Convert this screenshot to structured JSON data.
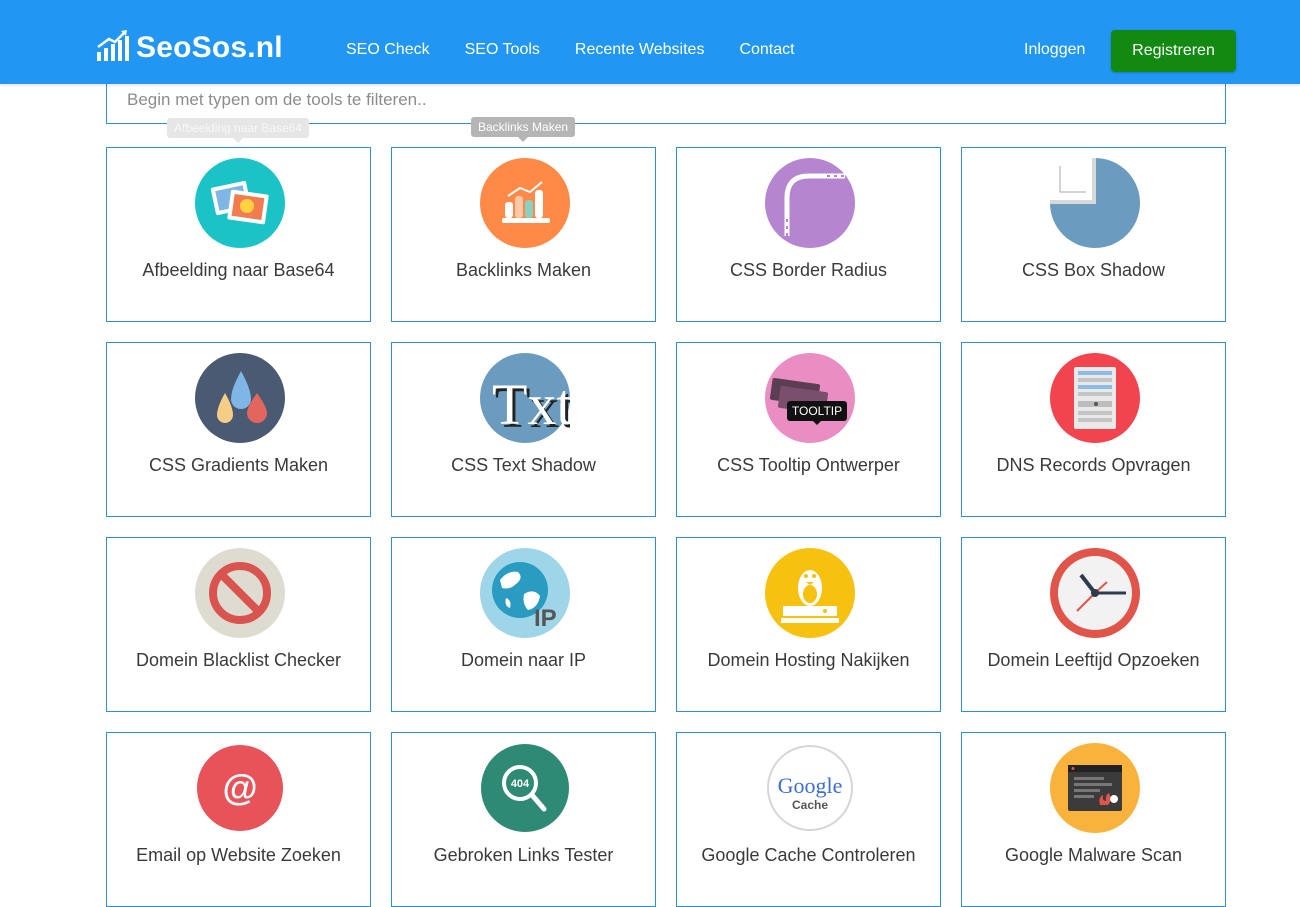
{
  "brand": {
    "name": "SeoSos.nl",
    "logo_icon": "bar-chart-up-icon"
  },
  "nav": {
    "links": [
      "SEO Check",
      "SEO Tools",
      "Recente Websites",
      "Contact"
    ],
    "login": "Inloggen",
    "register": "Registreren"
  },
  "search": {
    "placeholder": "Begin met typen om de tools te filteren.."
  },
  "tooltips": [
    "Afbeelding naar Base64",
    "Backlinks Maken"
  ],
  "tools": [
    {
      "label": "Afbeelding naar Base64",
      "icon": "image-icon",
      "color": "#1bc3c6"
    },
    {
      "label": "Backlinks Maken",
      "icon": "backlinks-chart-icon",
      "color": "#ff8a47"
    },
    {
      "label": "CSS Border Radius",
      "icon": "border-radius-icon",
      "color": "#b586cf"
    },
    {
      "label": "CSS Box Shadow",
      "icon": "box-shadow-icon",
      "color": "#6b9bbf"
    },
    {
      "label": "CSS Gradients Maken",
      "icon": "color-drops-icon",
      "color": "#4a5a72"
    },
    {
      "label": "CSS Text Shadow",
      "icon": "text-shadow-icon",
      "color": "#6b9bbf",
      "glyph": "Txt"
    },
    {
      "label": "CSS Tooltip Ontwerper",
      "icon": "tooltip-icon",
      "color": "#e98dc2",
      "glyph": "TOOLTIP"
    },
    {
      "label": "DNS Records Opvragen",
      "icon": "server-icon",
      "color": "#f2444f"
    },
    {
      "label": "Domein Blacklist Checker",
      "icon": "blocked-icon",
      "color": "#dedcd0"
    },
    {
      "label": "Domein naar IP",
      "icon": "globe-icon",
      "color": "#9ed5e8",
      "glyph": "IP"
    },
    {
      "label": "Domein Hosting Nakijken",
      "icon": "linux-server-icon",
      "color": "#f6c20f"
    },
    {
      "label": "Domein Leeftijd Opzoeken",
      "icon": "clock-icon",
      "color": "#e0544a"
    },
    {
      "label": "Email op Website Zoeken",
      "icon": "at-sign-icon",
      "color": "#e8535a",
      "glyph": "@"
    },
    {
      "label": "Gebroken Links Tester",
      "icon": "search-404-icon",
      "color": "#2e8a74",
      "glyph": "404"
    },
    {
      "label": "Google Cache Controleren",
      "icon": "google-cache-icon",
      "color": "#ffffff",
      "glyph": "Google",
      "glyph2": "Cache"
    },
    {
      "label": "Google Malware Scan",
      "icon": "malware-browser-icon",
      "color": "#f9b23c"
    }
  ]
}
